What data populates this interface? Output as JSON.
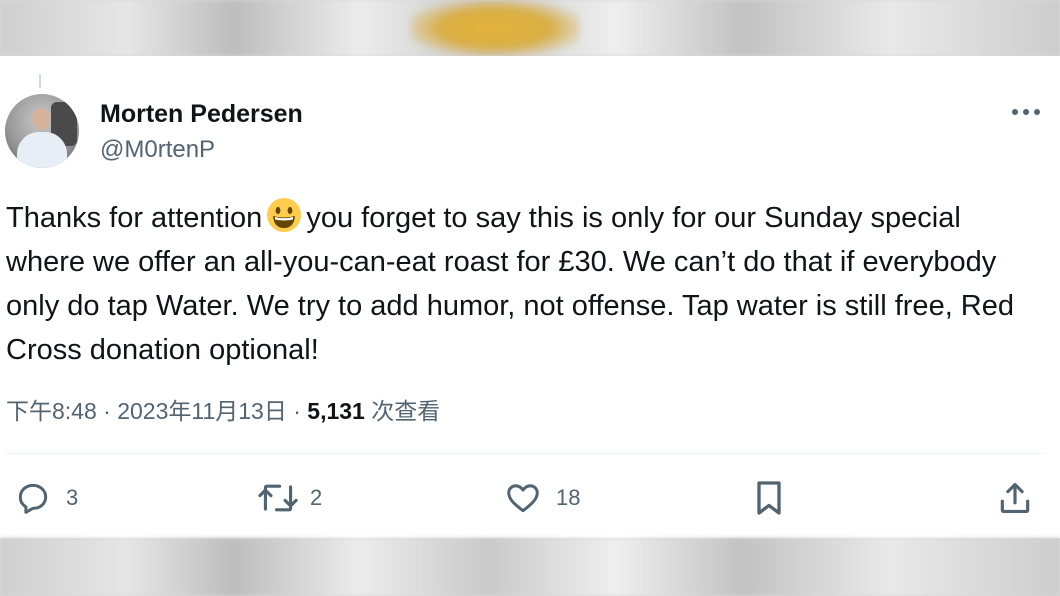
{
  "tweet": {
    "author_name": "Morten Pedersen",
    "author_handle": "@M0rtenP",
    "text_parts": [
      "Thanks for attention",
      "you forget to say this is only for our Sunday special where we offer an all-you-can-eat roast for £30. We can’t do that if everybody only do tap Water. We try to add humor, not offense. Tap water is still free, Red Cross donation optional!"
    ],
    "emoji": "grinning-face-emoji",
    "time": "下午8:48",
    "date": "2023年11月13日",
    "separator": "·",
    "views_count": "5,131",
    "views_label": "次查看"
  },
  "actions": {
    "replies": "3",
    "retweets": "2",
    "likes": "18"
  },
  "icons": [
    "more-icon",
    "reply-icon",
    "retweet-icon",
    "like-icon",
    "bookmark-icon",
    "share-icon"
  ],
  "colors": {
    "text_primary": "#0f1419",
    "text_secondary": "#536471",
    "divider": "#eff3f4"
  }
}
